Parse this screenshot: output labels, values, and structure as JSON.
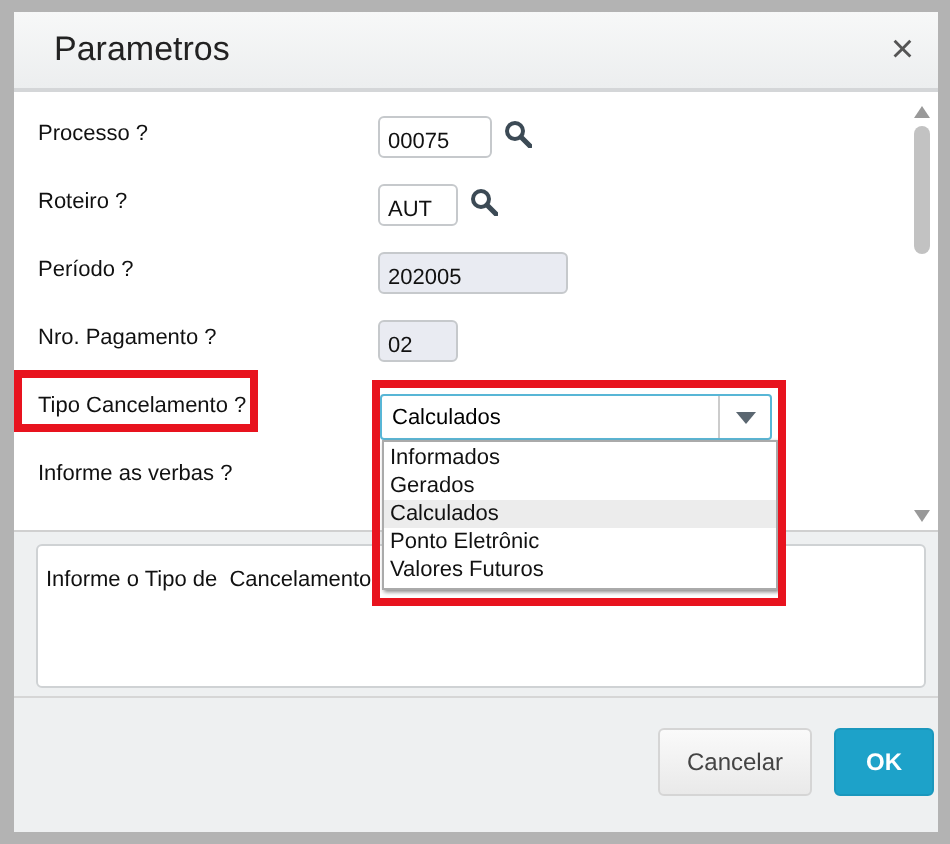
{
  "window": {
    "title": "Parametros",
    "close": "×"
  },
  "fields": [
    {
      "label": "Processo ?",
      "kind": "lookup",
      "value": "00075",
      "highlighted": false
    },
    {
      "label": "Roteiro ?",
      "kind": "lookup",
      "value": "AUT",
      "highlighted": false
    },
    {
      "label": "Período ?",
      "kind": "readonly",
      "value": "202005",
      "highlighted": false
    },
    {
      "label": "Nro. Pagamento ?",
      "kind": "readonly",
      "value": "02",
      "highlighted": false
    },
    {
      "label": "Tipo Cancelamento ?",
      "kind": "select",
      "value": "Calculados",
      "highlighted": true,
      "expanded": true,
      "options": [
        {
          "label": "Informados",
          "selected": false
        },
        {
          "label": "Gerados",
          "selected": false
        },
        {
          "label": "Calculados",
          "selected": true
        },
        {
          "label": "Ponto Eletrônic",
          "selected": false
        },
        {
          "label": "Valores Futuros",
          "selected": false
        }
      ]
    },
    {
      "label": "Informe as verbas ?",
      "kind": "label",
      "highlighted": false
    }
  ],
  "help": {
    "text": "Informe o Tipo de  Cancelamento"
  },
  "buttons": [
    {
      "label": "Cancelar",
      "kind": "secondary"
    },
    {
      "label": "OK",
      "kind": "primary"
    }
  ]
}
